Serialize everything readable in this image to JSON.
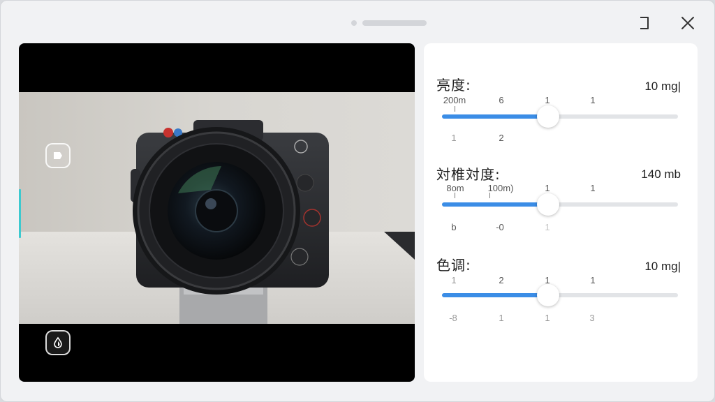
{
  "window": {
    "controls": {
      "restore_icon": "restore-icon",
      "close_icon": "close-icon"
    }
  },
  "preview": {
    "subject": "camera-with-lens",
    "overlay_top_icon": "tag-icon",
    "overlay_bottom_icon": "color-drop-icon"
  },
  "panel": {
    "sliders": [
      {
        "label": "亮度:",
        "value": "10 mg|",
        "level": 0.45,
        "ticks_top": [
          "200m",
          "6",
          "1",
          "1"
        ],
        "ticks_bottom": [
          "1",
          "2"
        ]
      },
      {
        "label": "対椎対度:",
        "value": "140 mb",
        "level": 0.45,
        "ticks_top": [
          "8om",
          "100m)",
          "1",
          "1"
        ],
        "ticks_bottom": [
          "b",
          "-0",
          "1"
        ]
      },
      {
        "label": "色调:",
        "value": "10 mg|",
        "level": 0.45,
        "ticks_top": [
          "1",
          "2",
          "1",
          "1"
        ],
        "ticks_bottom": [
          "-8",
          "1",
          "1",
          "3"
        ]
      }
    ],
    "accent_color": "#3b8de6"
  }
}
